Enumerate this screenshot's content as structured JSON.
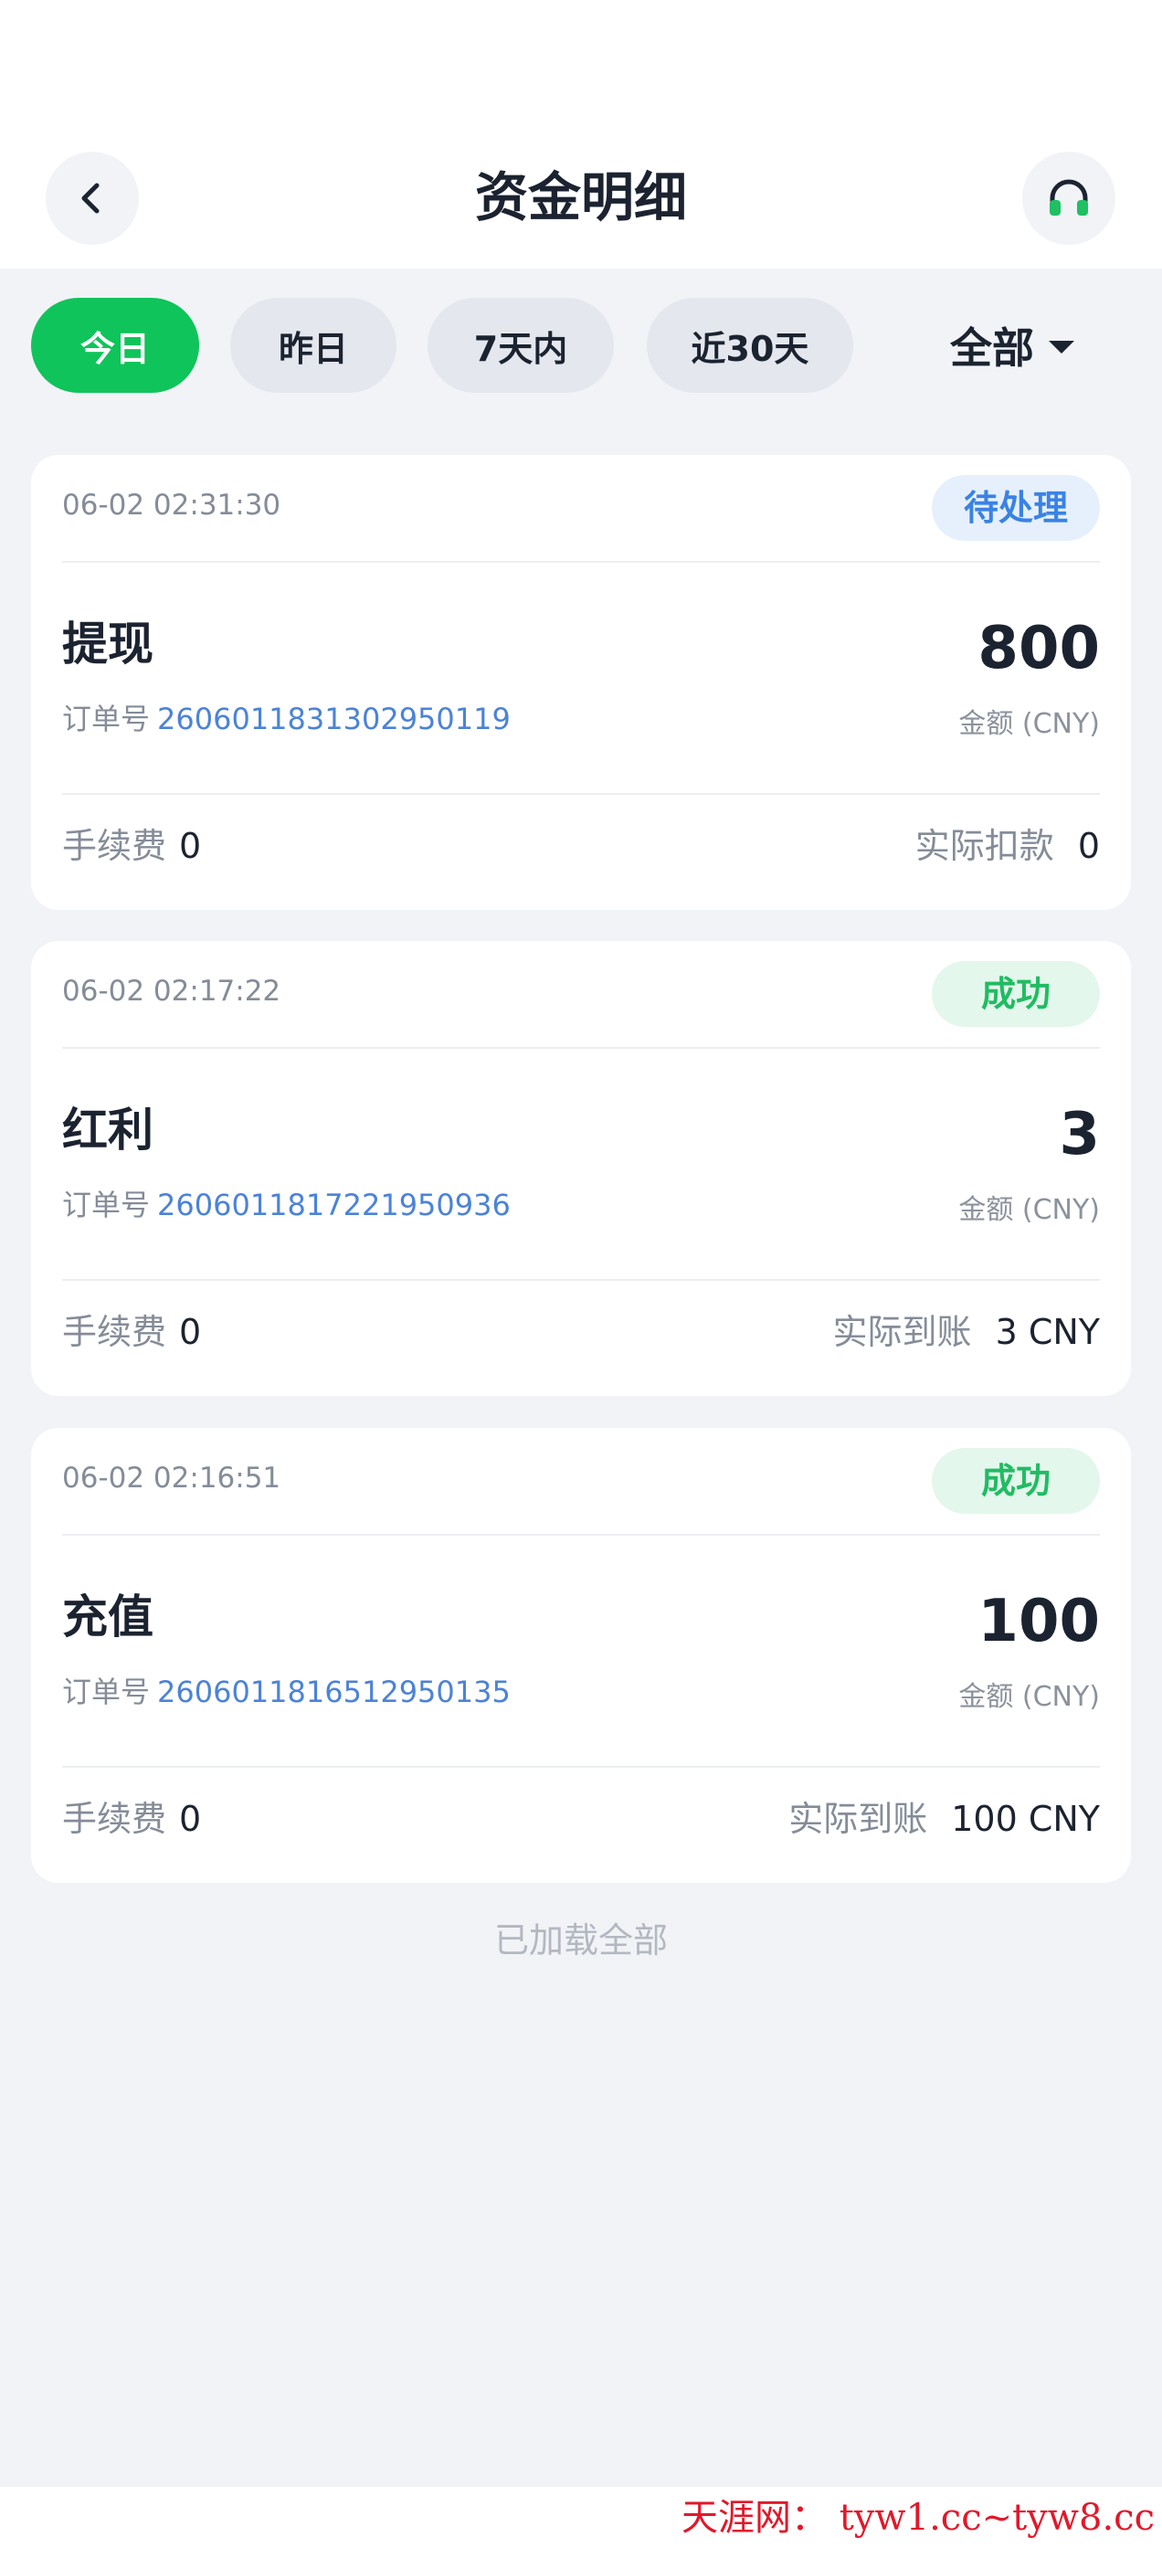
{
  "header": {
    "title": "资金明细",
    "back_icon": "chevron-left-icon",
    "support_icon": "headset-icon",
    "support_icon_color": "#1fbf63"
  },
  "filters": {
    "chips": [
      {
        "label": "今日",
        "active": true
      },
      {
        "label": "昨日",
        "active": false
      },
      {
        "label": "7天内",
        "active": false
      },
      {
        "label": "近30天",
        "active": false
      }
    ],
    "dropdown_label": "全部",
    "active_color": "#0fc45a"
  },
  "records": [
    {
      "time": "06-02 02:31:30",
      "status": "待处理",
      "status_type": "pending",
      "type": "提现",
      "amount": "800",
      "amount_label": "金额 (CNY)",
      "order_label": "订单号",
      "order_no": "2606011831302950119",
      "fee_label": "手续费",
      "fee": "0",
      "actual_label": "实际扣款",
      "actual": "0"
    },
    {
      "time": "06-02 02:17:22",
      "status": "成功",
      "status_type": "success",
      "type": "红利",
      "amount": "3",
      "amount_label": "金额 (CNY)",
      "order_label": "订单号",
      "order_no": "2606011817221950936",
      "fee_label": "手续费",
      "fee": "0",
      "actual_label": "实际到账",
      "actual": "3 CNY"
    },
    {
      "time": "06-02 02:16:51",
      "status": "成功",
      "status_type": "success",
      "type": "充值",
      "amount": "100",
      "amount_label": "金额 (CNY)",
      "order_label": "订单号",
      "order_no": "2606011816512950135",
      "fee_label": "手续费",
      "fee": "0",
      "actual_label": "实际到账",
      "actual": "100 CNY"
    }
  ],
  "footer": {
    "loaded_all": "已加载全部"
  },
  "watermark": "天涯网： tyw1.cc~tyw8.cc"
}
